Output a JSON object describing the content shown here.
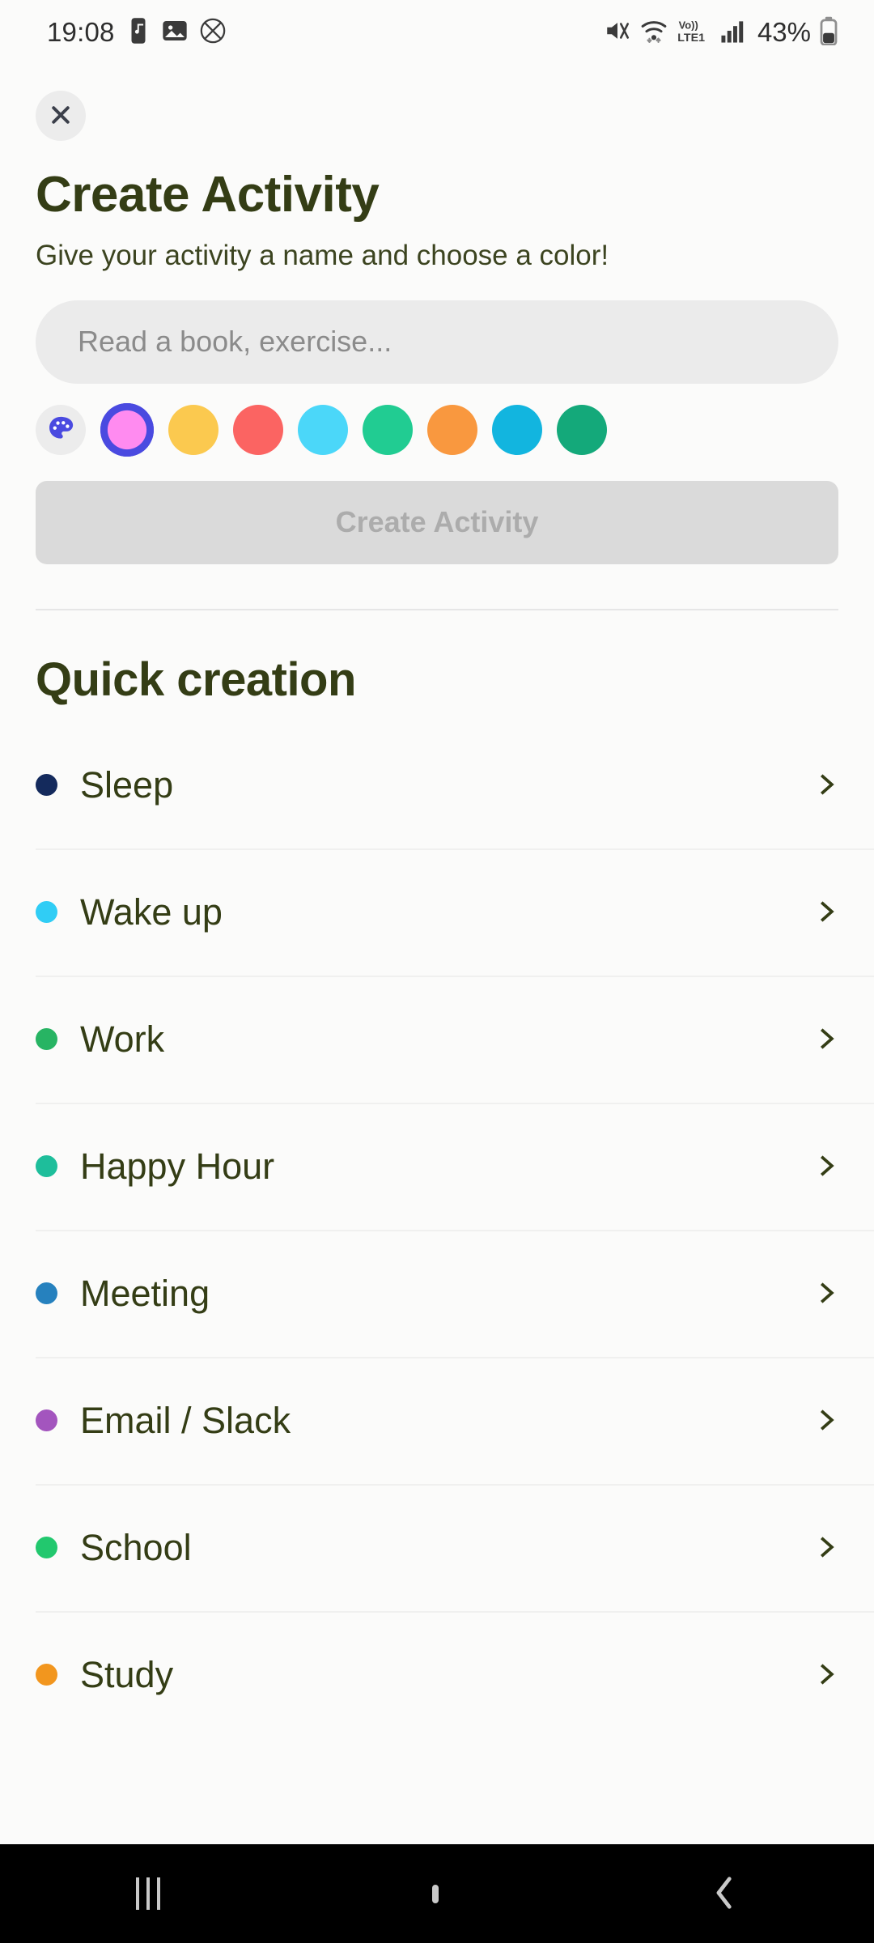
{
  "status_bar": {
    "time": "19:08",
    "battery_percent": "43%",
    "network_label": "LTE1",
    "volte_label": "Vo))",
    "icons": [
      "music-note-icon",
      "image-icon",
      "no-sim-icon",
      "mute-icon",
      "wifi-icon",
      "volte-icon",
      "signal-icon",
      "battery-icon"
    ]
  },
  "header": {
    "close_label": "×",
    "title": "Create Activity",
    "subtitle": "Give your activity a name and choose a color!"
  },
  "form": {
    "name_input_value": "",
    "name_input_placeholder": "Read a book, exercise...",
    "palette_button_name": "palette-icon",
    "submit_label": "Create Activity",
    "submit_disabled": true,
    "colors": [
      {
        "name": "pink",
        "hex": "#FF8BF0",
        "selected": true,
        "ring_hex": "#4A4AE0"
      },
      {
        "name": "yellow",
        "hex": "#FBC94F",
        "selected": false
      },
      {
        "name": "coral-red",
        "hex": "#FB6462",
        "selected": false
      },
      {
        "name": "sky-cyan",
        "hex": "#4BD7F9",
        "selected": false
      },
      {
        "name": "emerald",
        "hex": "#21CC92",
        "selected": false
      },
      {
        "name": "orange",
        "hex": "#F9983F",
        "selected": false
      },
      {
        "name": "azure",
        "hex": "#12B5DF",
        "selected": false
      },
      {
        "name": "green-teal",
        "hex": "#14A97A",
        "selected": false
      }
    ]
  },
  "quick_creation": {
    "title": "Quick creation",
    "items": [
      {
        "label": "Sleep",
        "color": "#142A5C"
      },
      {
        "label": "Wake up",
        "color": "#30CDF5"
      },
      {
        "label": "Work",
        "color": "#27B463"
      },
      {
        "label": "Happy Hour",
        "color": "#1EBE9B"
      },
      {
        "label": "Meeting",
        "color": "#2681BE"
      },
      {
        "label": "Email / Slack",
        "color": "#A355BE"
      },
      {
        "label": "School",
        "color": "#22C86E"
      },
      {
        "label": "Study",
        "color": "#F2961E"
      }
    ]
  },
  "nav_bar": {
    "recents_label": "recents-icon",
    "home_label": "home-icon",
    "back_label": "back-icon"
  },
  "theme": {
    "text_primary": "#343d15",
    "background": "#fbfbfa",
    "input_background": "#ebebeb",
    "disabled_button": "#dadada"
  }
}
